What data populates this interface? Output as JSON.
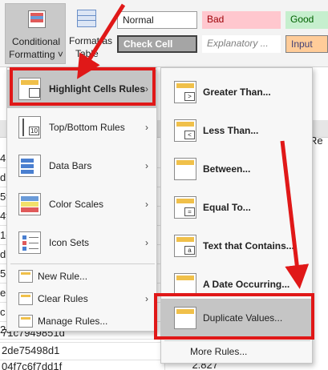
{
  "ribbon": {
    "conditional_formatting": {
      "line1": "Conditional",
      "line2": "Formatting ˅"
    },
    "format_as_table": {
      "line1": "Format as",
      "line2": "Table"
    },
    "styles": {
      "normal": "Normal",
      "bad": "Bad",
      "good": "Good",
      "check_cell": "Check Cell",
      "explanatory": "Explanatory ...",
      "input": "Input"
    }
  },
  "sheet": {
    "column_partial_label": "Re",
    "row_fragments": [
      "4",
      "d",
      "5f",
      "4f",
      "1e",
      "d",
      "5",
      "e",
      "c",
      "2e",
      "71c7949851d",
      "2de75498d1",
      "04f7c6f7dd1f"
    ],
    "value_cell": "2.827"
  },
  "menu": {
    "items": [
      {
        "label": "Highlight Cells Rules",
        "icon": "highlight-cells-icon",
        "has_submenu": true
      },
      {
        "label": "Top/Bottom Rules",
        "icon": "top-bottom-icon",
        "has_submenu": true
      },
      {
        "label": "Data Bars",
        "icon": "data-bars-icon",
        "has_submenu": true
      },
      {
        "label": "Color Scales",
        "icon": "color-scales-icon",
        "has_submenu": true
      },
      {
        "label": "Icon Sets",
        "icon": "icon-sets-icon",
        "has_submenu": true
      }
    ],
    "small_items": [
      {
        "label": "New Rule...",
        "icon": "new-rule-icon",
        "has_submenu": false
      },
      {
        "label": "Clear Rules",
        "icon": "clear-rules-icon",
        "has_submenu": true
      },
      {
        "label": "Manage Rules...",
        "icon": "manage-rules-icon",
        "has_submenu": false
      }
    ],
    "submenu_arrow": "›"
  },
  "submenu": {
    "items": [
      {
        "label": "Greater Than...",
        "badge": ">"
      },
      {
        "label": "Less Than...",
        "badge": "<"
      },
      {
        "label": "Between...",
        "badge": ""
      },
      {
        "label": "Equal To...",
        "badge": "="
      },
      {
        "label": "Text that Contains...",
        "badge": "a"
      },
      {
        "label": "A Date Occurring...",
        "badge": ""
      },
      {
        "label": "Duplicate Values...",
        "badge": ""
      }
    ],
    "more_rules": "More Rules..."
  },
  "colors": {
    "highlight_box": "#e01818",
    "menu_highlight": "#c5c5c5"
  }
}
